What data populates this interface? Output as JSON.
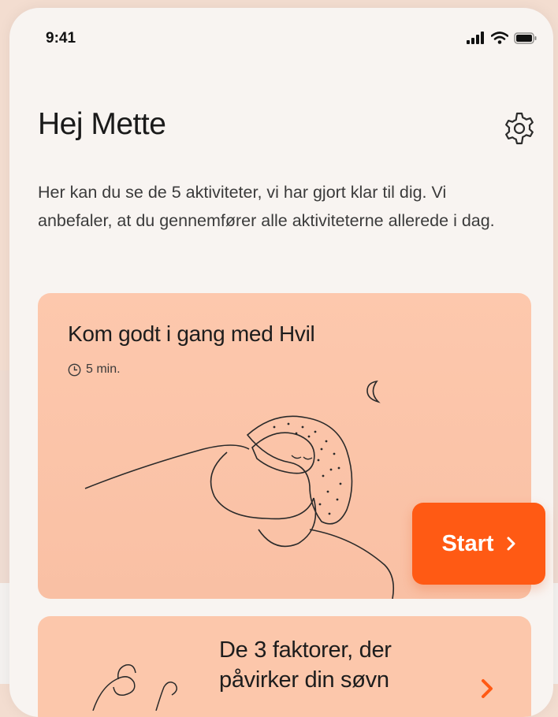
{
  "status_bar": {
    "time": "9:41",
    "icons": [
      "signal-icon",
      "wifi-icon",
      "battery-icon"
    ]
  },
  "header": {
    "greeting": "Hej Mette",
    "settings_icon": "gear-icon"
  },
  "intro": {
    "text": "Her kan du se de 5 aktiviteter, vi har gjort klar til dig. Vi anbefaler, at du gennemfører alle aktiviteterne allerede i dag."
  },
  "activities": [
    {
      "title": "Kom godt i gang med Hvil",
      "duration": "5 min.",
      "duration_icon": "clock-icon",
      "action_label": "Start",
      "action_icon": "chevron-right-icon"
    },
    {
      "title": "De 3 faktorer, der påvirker din søvn",
      "action_icon": "chevron-right-icon"
    }
  ],
  "colors": {
    "page_bg": "#f8f4f1",
    "card_bg": "#fcc7ab",
    "accent": "#ff5a14",
    "text": "#1d1d1d"
  }
}
